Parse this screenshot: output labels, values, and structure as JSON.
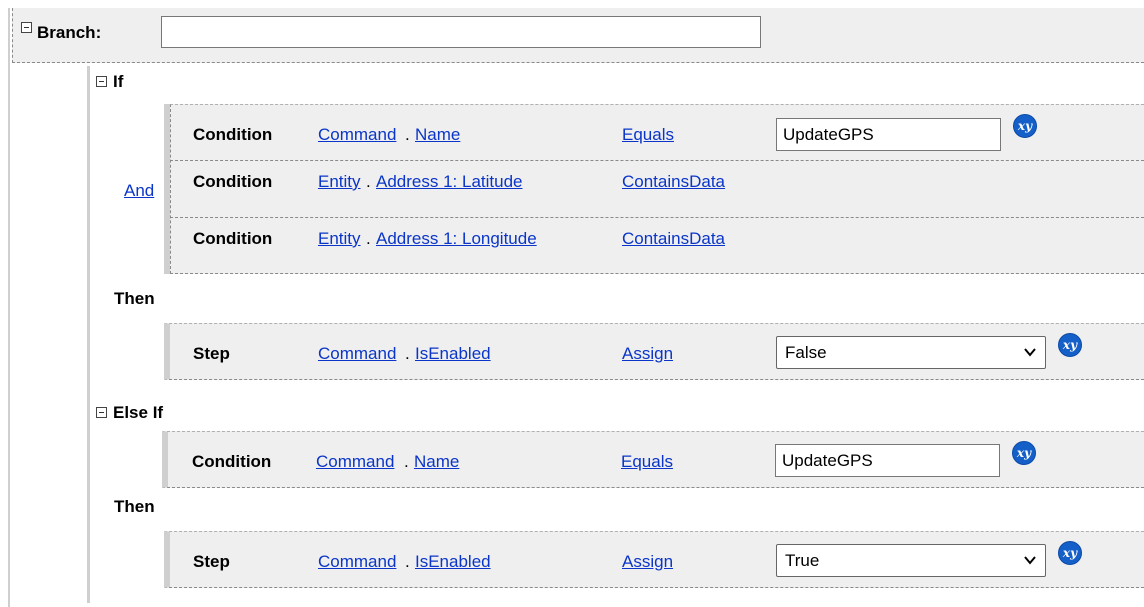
{
  "branch": {
    "label": "Branch:",
    "input_value": ""
  },
  "if_block": {
    "label": "If",
    "group_operator": "And",
    "conditions": [
      {
        "type": "Condition",
        "entity": "Command",
        "attribute": "Name",
        "operator": "Equals",
        "value": "UpdateGPS"
      },
      {
        "type": "Condition",
        "entity": "Entity",
        "attribute": "Address 1: Latitude",
        "operator": "ContainsData"
      },
      {
        "type": "Condition",
        "entity": "Entity",
        "attribute": "Address 1: Longitude",
        "operator": "ContainsData"
      }
    ],
    "then_label": "Then",
    "step": {
      "type": "Step",
      "entity": "Command",
      "attribute": "IsEnabled",
      "operator": "Assign",
      "value": "False"
    }
  },
  "else_if_block": {
    "label": "Else If",
    "condition": {
      "type": "Condition",
      "entity": "Command",
      "attribute": "Name",
      "operator": "Equals",
      "value": "UpdateGPS"
    },
    "then_label": "Then",
    "step": {
      "type": "Step",
      "entity": "Command",
      "attribute": "IsEnabled",
      "operator": "Assign",
      "value": "True"
    }
  },
  "separator": ".",
  "icons": {
    "collapse": "collapse-minus-icon",
    "expression": "xy-expression-icon",
    "dropdown": "chevron-down-icon"
  },
  "colors": {
    "link": "#0a35c8",
    "panel_bg": "#efefef",
    "xy_badge": "#1560c8"
  }
}
